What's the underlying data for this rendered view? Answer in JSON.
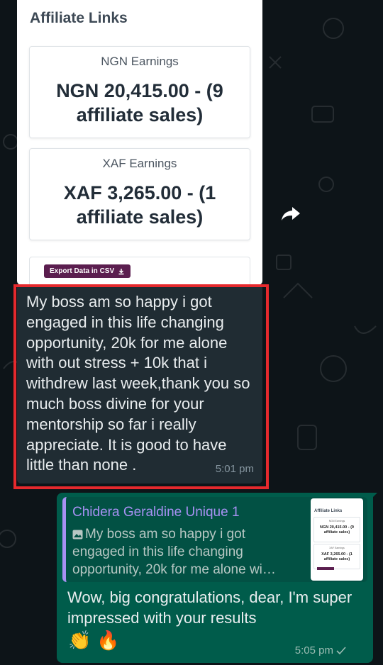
{
  "screenshot": {
    "title": "Affiliate Links",
    "earnings": [
      {
        "label": "NGN Earnings",
        "amount": "NGN 20,415.00 - (9 affiliate sales)"
      },
      {
        "label": "XAF Earnings",
        "amount": "XAF 3,265.00 - (1 affiliate sales)"
      }
    ],
    "export_label": "Export Data in CSV"
  },
  "incoming": {
    "text": "My boss am so happy i got engaged in this life changing opportunity, 20k for me alone with out stress + 10k that i withdrew last week,thank you so much boss divine for your mentorship so far i really appreciate. It is good to have little than none .",
    "time": "5:01 pm"
  },
  "outgoing": {
    "quote_name": "Chidera Geraldine Unique 1",
    "quote_text": "My boss am so happy i got engaged in this life changing opportunity, 20k for me alone wi…",
    "text": "Wow, big congratulations, dear, I'm super impressed with your results",
    "emojis": [
      "👏",
      "🔥"
    ],
    "time": "5:05 pm",
    "thumb": {
      "title": "Affiliate Links",
      "earnings": [
        {
          "label": "NGN Earnings",
          "amount": "NGN 20,415.00 - (9 affiliate sales)"
        },
        {
          "label": "XAF Earnings",
          "amount": "XAF 3,265.00 - (1 affiliate sales)"
        }
      ]
    }
  },
  "colors": {
    "background": "#0d1418",
    "incoming_bubble": "#202c33",
    "outgoing_bubble": "#005c4b",
    "highlight": "#e6292d",
    "quote_name": "#a791f3",
    "export_button": "#5b1e4f"
  },
  "icons": [
    "forward-icon",
    "download-icon",
    "photo-icon",
    "check-icon"
  ]
}
